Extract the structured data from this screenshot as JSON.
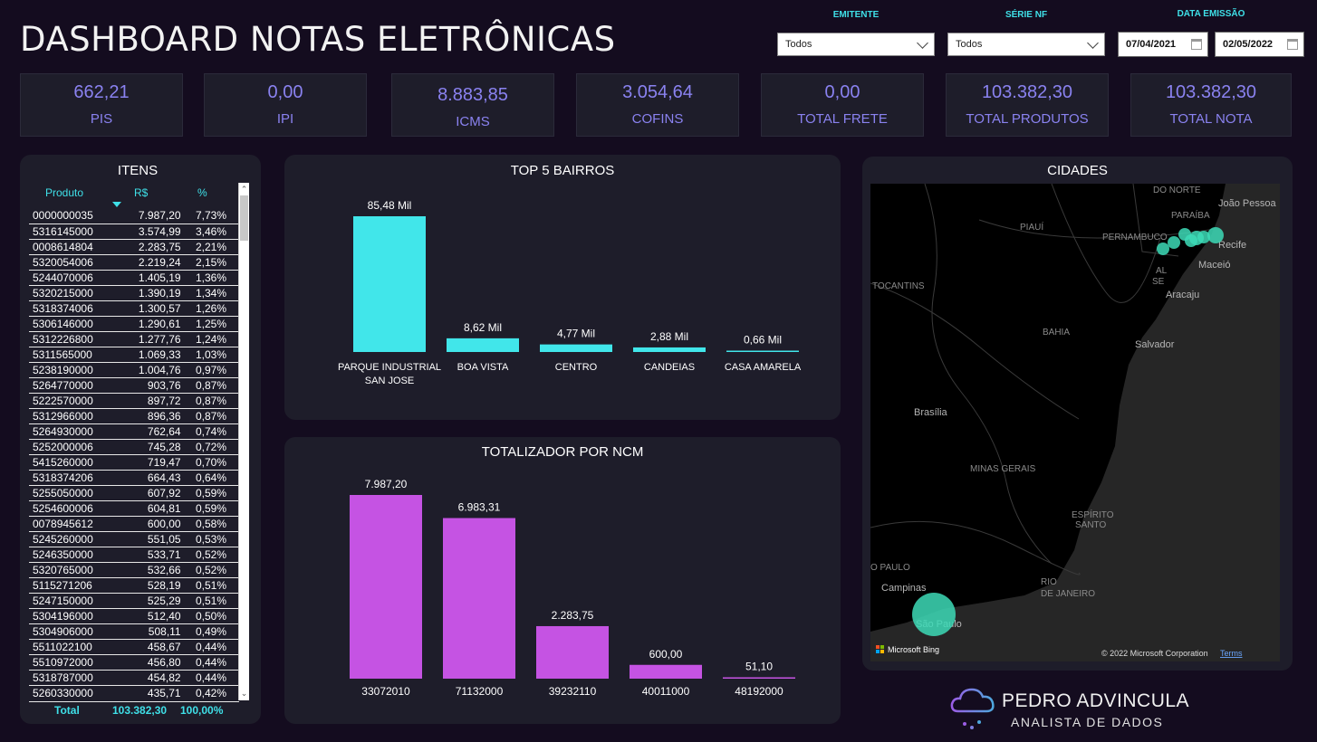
{
  "header": {
    "title": "DASHBOARD NOTAS ELETRÔNICAS"
  },
  "filters": {
    "emitente_label": "EMITENTE",
    "emitente_value": "Todos",
    "serie_label": "SÉRIE NF",
    "serie_value": "Todos",
    "data_label": "DATA EMISSÃO",
    "date_start": "07/04/2021",
    "date_end": "02/05/2022"
  },
  "kpis": [
    {
      "value": "662,21",
      "label": "PIS"
    },
    {
      "value": "0,00",
      "label": "IPI"
    },
    {
      "value": "8.883,85",
      "label": "ICMS"
    },
    {
      "value": "3.054,64",
      "label": "COFINS"
    },
    {
      "value": "0,00",
      "label": "TOTAL FRETE"
    },
    {
      "value": "103.382,30",
      "label": "TOTAL PRODUTOS"
    },
    {
      "value": "103.382,30",
      "label": "TOTAL NOTA"
    }
  ],
  "items": {
    "title": "ITENS",
    "columns": [
      "Produto",
      "R$",
      "%"
    ],
    "rows": [
      [
        "0000000035",
        "7.987,20",
        "7,73%"
      ],
      [
        "5316145000",
        "3.574,99",
        "3,46%"
      ],
      [
        "0008614804",
        "2.283,75",
        "2,21%"
      ],
      [
        "5320054006",
        "2.219,24",
        "2,15%"
      ],
      [
        "5244070006",
        "1.405,19",
        "1,36%"
      ],
      [
        "5320215000",
        "1.390,19",
        "1,34%"
      ],
      [
        "5318374006",
        "1.300,57",
        "1,26%"
      ],
      [
        "5306146000",
        "1.290,61",
        "1,25%"
      ],
      [
        "5312226800",
        "1.277,76",
        "1,24%"
      ],
      [
        "5311565000",
        "1.069,33",
        "1,03%"
      ],
      [
        "5238190000",
        "1.004,76",
        "0,97%"
      ],
      [
        "5264770000",
        "903,76",
        "0,87%"
      ],
      [
        "5222570000",
        "897,72",
        "0,87%"
      ],
      [
        "5312966000",
        "896,36",
        "0,87%"
      ],
      [
        "5264930000",
        "762,64",
        "0,74%"
      ],
      [
        "5252000006",
        "745,28",
        "0,72%"
      ],
      [
        "5415260000",
        "719,47",
        "0,70%"
      ],
      [
        "5318374206",
        "664,43",
        "0,64%"
      ],
      [
        "5255050000",
        "607,92",
        "0,59%"
      ],
      [
        "5254600006",
        "604,81",
        "0,59%"
      ],
      [
        "0078945612",
        "600,00",
        "0,58%"
      ],
      [
        "5245260000",
        "551,05",
        "0,53%"
      ],
      [
        "5246350000",
        "533,71",
        "0,52%"
      ],
      [
        "5320765000",
        "532,66",
        "0,52%"
      ],
      [
        "5115271206",
        "528,19",
        "0,51%"
      ],
      [
        "5247150000",
        "525,29",
        "0,51%"
      ],
      [
        "5304196000",
        "512,40",
        "0,50%"
      ],
      [
        "5304906000",
        "508,11",
        "0,49%"
      ],
      [
        "5511022100",
        "458,67",
        "0,44%"
      ],
      [
        "5510972000",
        "456,80",
        "0,44%"
      ],
      [
        "5318787000",
        "454,82",
        "0,44%"
      ],
      [
        "5260330000",
        "435,71",
        "0,42%"
      ]
    ],
    "total_label": "Total",
    "total_value": "103.382,30",
    "total_pct": "100,00%"
  },
  "bairros_title": "TOP 5 BAIRROS",
  "ncm_title": "TOTALIZADOR POR NCM",
  "chart_data": [
    {
      "type": "bar",
      "title": "TOP 5 BAIRROS",
      "categories": [
        "PARQUE INDUSTRIAL SAN JOSE",
        "BOA VISTA",
        "CENTRO",
        "CANDEIAS",
        "CASA AMARELA"
      ],
      "values": [
        85.48,
        8.62,
        4.77,
        2.88,
        0.66
      ],
      "data_labels": [
        "85,48 Mil",
        "8,62 Mil",
        "4,77 Mil",
        "2,88 Mil",
        "0,66 Mil"
      ],
      "color": "#41e6ea"
    },
    {
      "type": "bar",
      "title": "TOTALIZADOR POR NCM",
      "categories": [
        "33072010",
        "71132000",
        "39232110",
        "40011000",
        "48192000"
      ],
      "values": [
        7987.2,
        6983.31,
        2283.75,
        600.0,
        51.1
      ],
      "data_labels": [
        "7.987,20",
        "6.983,31",
        "2.283,75",
        "600,00",
        "51,10"
      ],
      "color": "#c553e3"
    }
  ],
  "map": {
    "title": "CIDADES",
    "labels": {
      "do_norte": "DO NORTE",
      "joao_pessoa": "João Pessoa",
      "paraiba": "PARAÍBA",
      "piaui": "PIAUÍ",
      "pernambuco": "PERNAMBUCO",
      "recife": "Recife",
      "al": "AL",
      "maceio": "Maceió",
      "se": "SE",
      "tocantins": "TOCANTINS",
      "aracaju": "Aracaju",
      "bahia": "BAHIA",
      "salvador": "Salvador",
      "brasilia": "Brasília",
      "minas_gerais": "MINAS GERAIS",
      "espirito": "ESPÍRITO",
      "santo": "SANTO",
      "sao_paulo_state": "O PAULO",
      "rio": "RIO",
      "de_janeiro": "DE JANEIRO",
      "campinas": "Campinas",
      "sao_paulo": "São Paulo"
    },
    "bing": "Microsoft Bing",
    "copyright": "© 2022 Microsoft Corporation",
    "terms": "Terms"
  },
  "brand": {
    "name": "PEDRO ADVINCULA",
    "subtitle": "ANALISTA DE DADOS"
  },
  "colors": {
    "accent_cyan": "#41e6ea",
    "accent_purple": "#c553e3",
    "kpi_text": "#8a82f0",
    "map_bubble": "#3ddbb7"
  }
}
